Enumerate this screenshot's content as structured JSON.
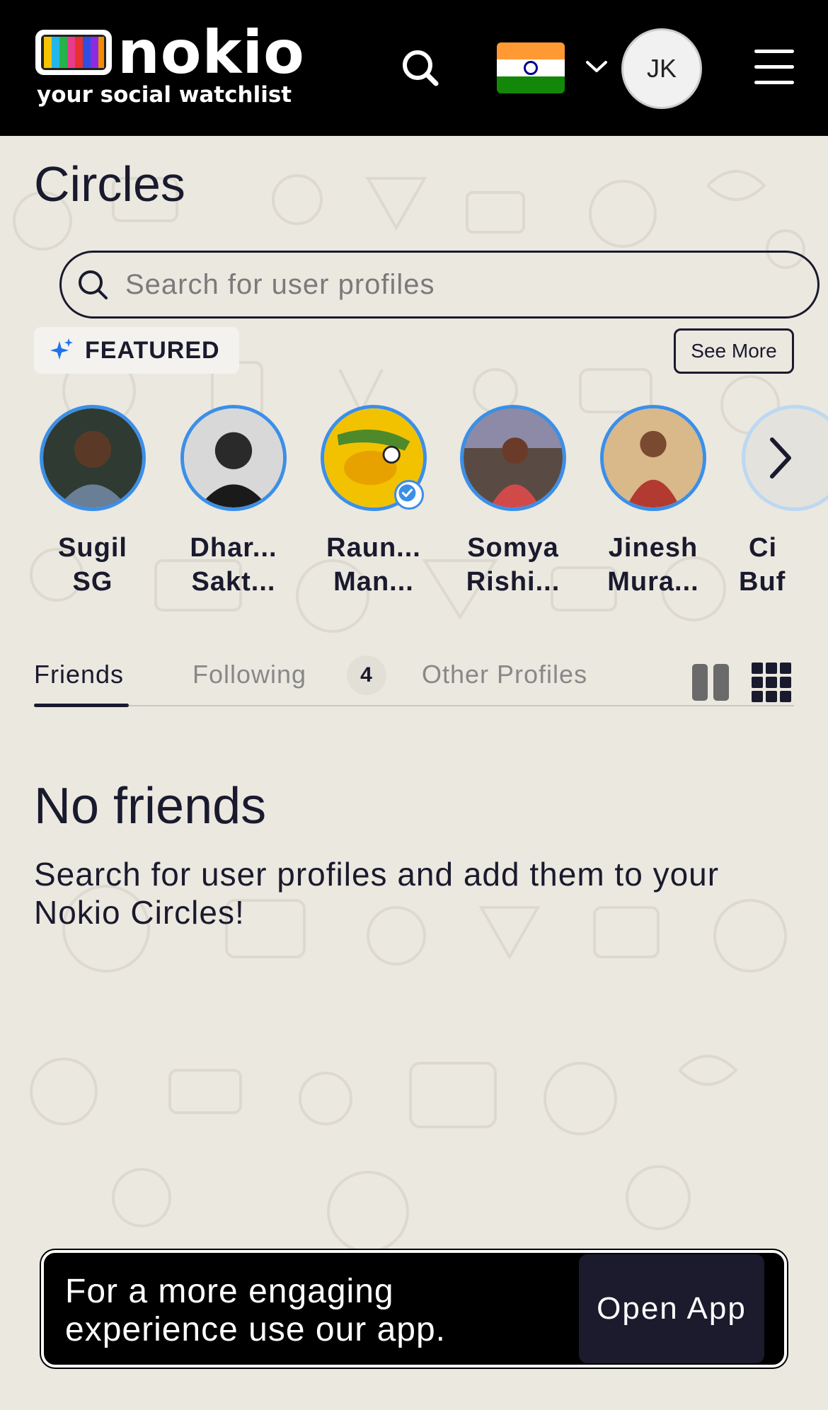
{
  "header": {
    "logo_word": "nokio",
    "logo_tagline": "your social watchlist",
    "avatar_initials": "JK"
  },
  "page": {
    "title": "Circles",
    "search_placeholder": "Search for user profiles"
  },
  "featured": {
    "label": "FEATURED",
    "see_more": "See More",
    "profiles": [
      {
        "line1": "Sugil",
        "line2": "SG",
        "verified": false
      },
      {
        "line1": "Dhar...",
        "line2": "Sakt...",
        "verified": false
      },
      {
        "line1": "Raun...",
        "line2": "Man...",
        "verified": true
      },
      {
        "line1": "Somya",
        "line2": "Rishi...",
        "verified": false
      },
      {
        "line1": "Jinesh",
        "line2": "Mura...",
        "verified": false
      },
      {
        "line1": "Ci",
        "line2": "Buf",
        "verified": false
      }
    ]
  },
  "tabs": {
    "friends": "Friends",
    "following": "Following",
    "following_count": "4",
    "other": "Other Profiles"
  },
  "empty_state": {
    "title": "No friends",
    "text": "Search for user profiles and add them to your Nokio Circles!"
  },
  "app_banner": {
    "message": "For a more engaging experience use our app.",
    "button": "Open App"
  },
  "colors": {
    "accent_ring": "#3b8fe8",
    "header_bg": "#000000",
    "page_bg": "#ebe8e0"
  }
}
